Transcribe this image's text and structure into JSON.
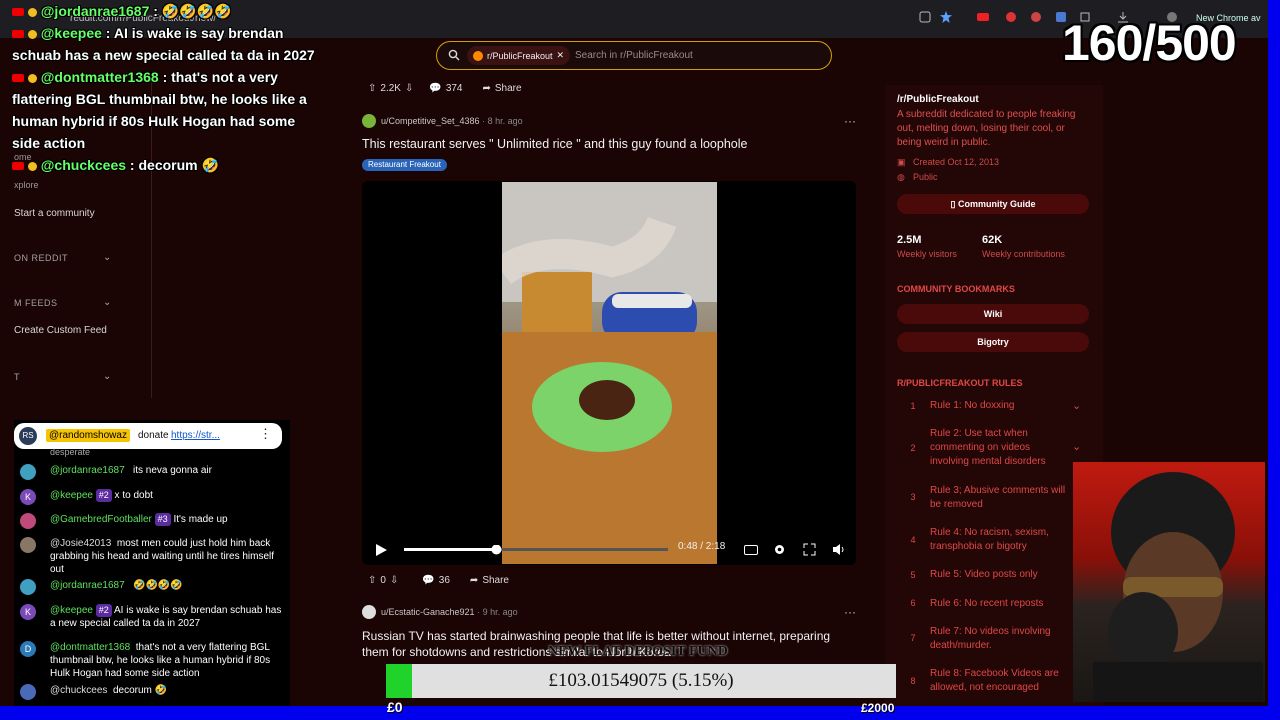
{
  "browser": {
    "address": "reddit.com/r/PublicFreakout/new/",
    "new_chrome_label": "New Chrome av"
  },
  "search": {
    "chip_label": "r/PublicFreakout",
    "placeholder": "Search in r/PublicFreakout"
  },
  "leftnav": {
    "home": "ome",
    "items": [
      "Start a community",
      "Create Custom Feed"
    ],
    "headers": [
      "ON REDDIT",
      "M FEEDS",
      "T"
    ],
    "explore": "xplore"
  },
  "post1": {
    "upvotes": "2.2K",
    "comments": "374",
    "share": "Share",
    "user": "u/Competitive_Set_4386",
    "time": "· 8 hr. ago",
    "title": "This restaurant serves \" Unlimited rice \" and this guy found a loophole",
    "flair": "Restaurant Freakout",
    "video_time": "0:48 / 2:18",
    "progress": 0.35
  },
  "post1_footer": {
    "upvotes": "0",
    "comments": "36",
    "share": "Share"
  },
  "post2": {
    "user": "u/Ecstatic-Ganache921",
    "time": "· 9 hr. ago",
    "title": "Russian TV has started brainwashing people that life is better without internet, preparing them for shotdowns and restrictions similar to North Korea"
  },
  "sidebar": {
    "name": "/r/PublicFreakout",
    "desc": "A subreddit dedicated to people freaking out, melting down, losing their cool, or being weird in public.",
    "created": "Created Oct 12, 2013",
    "visibility": "Public",
    "guide_btn": "Community Guide",
    "visitors": "2.5M",
    "visitors_label": "Weekly visitors",
    "contribs": "62K",
    "contribs_label": "Weekly contributions",
    "bookmarks_header": "COMMUNITY BOOKMARKS",
    "bookmarks": [
      "Wiki",
      "Bigotry"
    ],
    "rules_header": "R/PUBLICFREAKOUT RULES",
    "rules": [
      {
        "n": "1",
        "t": "Rule 1: No doxxing"
      },
      {
        "n": "2",
        "t": "Rule 2: Use tact when commenting on videos involving mental disorders"
      },
      {
        "n": "3",
        "t": "Rule 3; Abusive comments will be removed"
      },
      {
        "n": "4",
        "t": "Rule 4: No racism, sexism, transphobia or bigotry"
      },
      {
        "n": "5",
        "t": "Rule 5: Video posts only"
      },
      {
        "n": "6",
        "t": "Rule 6: No recent reposts"
      },
      {
        "n": "7",
        "t": "Rule 7: No videos involving death/murder."
      },
      {
        "n": "8",
        "t": "Rule 8: Facebook Videos are allowed, not encouraged"
      }
    ]
  },
  "overlay": {
    "counter": "160/500",
    "lines": [
      {
        "name": "@jordanrae1687",
        "text": " : 🤣🤣🤣🤣"
      },
      {
        "name": "@keepee",
        "text": " : AI is wake is say brendan schuab has a new special called ta da in 2027"
      },
      {
        "name": "@dontmatter1368",
        "text": " : that's not a very flattering BGL thumbnail btw, he looks like a human hybrid if 80s Hulk Hogan had some side action"
      },
      {
        "name": "@chuckcees",
        "text": " : decorum 🤣"
      }
    ]
  },
  "chat": {
    "pinned_user": "@randomshowaz",
    "pinned_text": "donate",
    "pinned_link": "https://str...",
    "pinned_tail": "desperate",
    "rows": [
      {
        "user": "@jordanrae1687",
        "badge": "",
        "text": "its neva gonna air"
      },
      {
        "user": "@keepee",
        "badge": "#2",
        "text": "x to dobt"
      },
      {
        "user": "@GamebredFootballer",
        "badge": "#3",
        "text": "It's made up"
      },
      {
        "user": "@Josie42013",
        "badge": "",
        "text": "most men could just hold him back grabbing his head and waiting until he tires himself out"
      },
      {
        "user": "@jordanrae1687",
        "badge": "",
        "text": "🤣🤣🤣🤣"
      },
      {
        "user": "@keepee",
        "badge": "#2",
        "text": "AI is wake is say brendan schuab has a new special called ta da in 2027"
      },
      {
        "user": "@dontmatter1368",
        "badge": "",
        "text": "that's not a very flattering BGL thumbnail btw, he looks like a human hybrid if 80s Hulk Hogan had some side action"
      },
      {
        "user": "@chuckcees",
        "badge": "",
        "text": "decorum 🤣"
      }
    ]
  },
  "fund": {
    "title": "NEW FLAT DEPOSIT FUND",
    "amount": "£103.01549075 (5.15%)",
    "fraction": 0.0515,
    "min": "£0",
    "max": "£2000"
  }
}
